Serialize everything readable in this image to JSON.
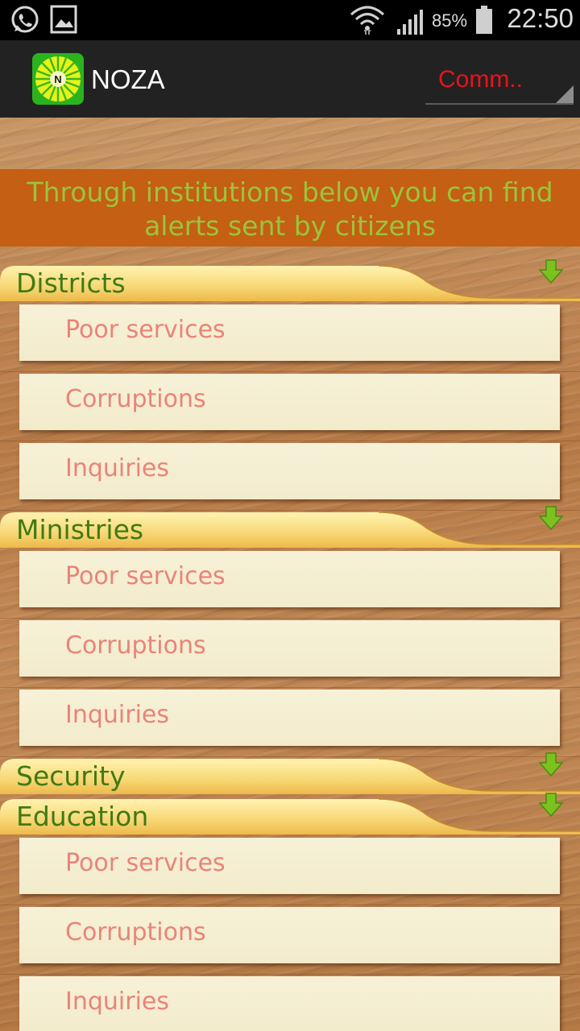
{
  "status_bar": {
    "battery_percent": "85%",
    "time": "22:50",
    "icons": [
      "whatsapp-icon",
      "image-notification-icon",
      "wifi-icon",
      "signal-icon",
      "battery-icon"
    ]
  },
  "action_bar": {
    "app_name": "NOZA",
    "logo_letter": "N",
    "spinner_value": "Comm..",
    "colors": {
      "spinner_text": "#e8141b",
      "bar": "#222222"
    }
  },
  "banner": {
    "line1": "Through institutions below you can find",
    "line2": "alerts sent by citizens",
    "colors": {
      "background": "#c45f13",
      "text": "#9bc43a"
    }
  },
  "groups": [
    {
      "label": "Districts",
      "items": [
        "Poor services",
        "Corruptions",
        "Inquiries"
      ]
    },
    {
      "label": "Ministries",
      "items": [
        "Poor services",
        "Corruptions",
        "Inquiries"
      ]
    },
    {
      "label": "Security",
      "items": []
    },
    {
      "label": "Education",
      "items": [
        "Poor services",
        "Corruptions",
        "Inquiries"
      ]
    }
  ],
  "colors": {
    "group_label": "#3f7a14",
    "item_label": "#e98478",
    "expand_arrow": "#7cc21f"
  }
}
